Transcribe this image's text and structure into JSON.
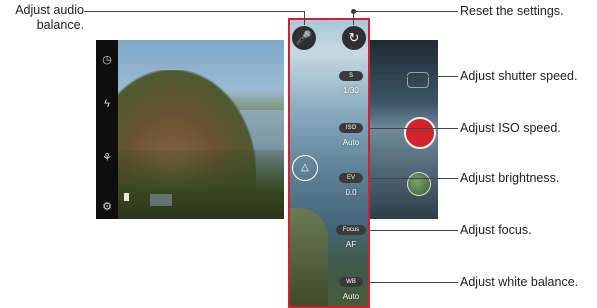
{
  "callouts": {
    "audio": "Adjust audio\nbalance.",
    "reset": "Reset the settings.",
    "shutter": "Adjust shutter speed.",
    "iso": "Adjust ISO speed.",
    "brightness": "Adjust brightness.",
    "focus": "Adjust focus.",
    "white_balance": "Adjust white balance."
  },
  "settings": {
    "shutter": {
      "label": "S",
      "value": "1/30"
    },
    "iso": {
      "label": "ISO",
      "value": "Auto"
    },
    "ev": {
      "label": "EV",
      "value": "0.0"
    },
    "focus": {
      "label": "Focus",
      "value": "AF"
    },
    "wb": {
      "label": "WB",
      "value": "Auto"
    }
  },
  "icons": {
    "mic": "microphone-icon",
    "reset": "reset-icon",
    "timer": "timer-icon",
    "flash_off": "flash-off-icon",
    "filter": "filter-icon",
    "settings": "gear-icon",
    "focus": "focus-icon"
  },
  "colors": {
    "highlight": "#d21f32",
    "shutter_button": "#d3222a"
  }
}
